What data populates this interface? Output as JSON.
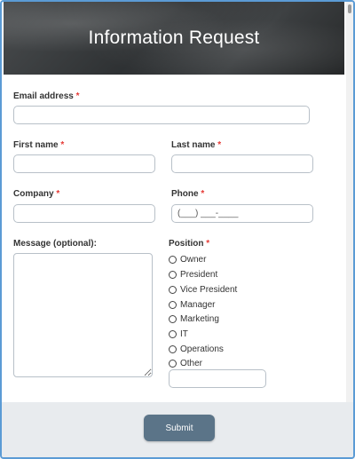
{
  "header": {
    "title": "Information Request"
  },
  "fields": {
    "email": {
      "label": "Email address",
      "required_mark": "*",
      "value": "",
      "placeholder": ""
    },
    "first_name": {
      "label": "First name",
      "required_mark": "*",
      "value": ""
    },
    "last_name": {
      "label": "Last name",
      "required_mark": "*",
      "value": ""
    },
    "company": {
      "label": "Company",
      "required_mark": "*",
      "value": ""
    },
    "phone": {
      "label": "Phone",
      "required_mark": "*",
      "placeholder": "(___) ___-____"
    },
    "message": {
      "label": "Message (optional):"
    }
  },
  "position": {
    "label": "Position",
    "required_mark": "*",
    "options": [
      "Owner",
      "President",
      "Vice President",
      "Manager",
      "Marketing",
      "IT",
      "Operations",
      "Other"
    ],
    "other_value": ""
  },
  "footer": {
    "submit_label": "Submit"
  },
  "colors": {
    "frame_border": "#5b9bd5",
    "required": "#e53935",
    "submit_bg": "#5b7488",
    "footer_bg": "#e8ebee"
  }
}
